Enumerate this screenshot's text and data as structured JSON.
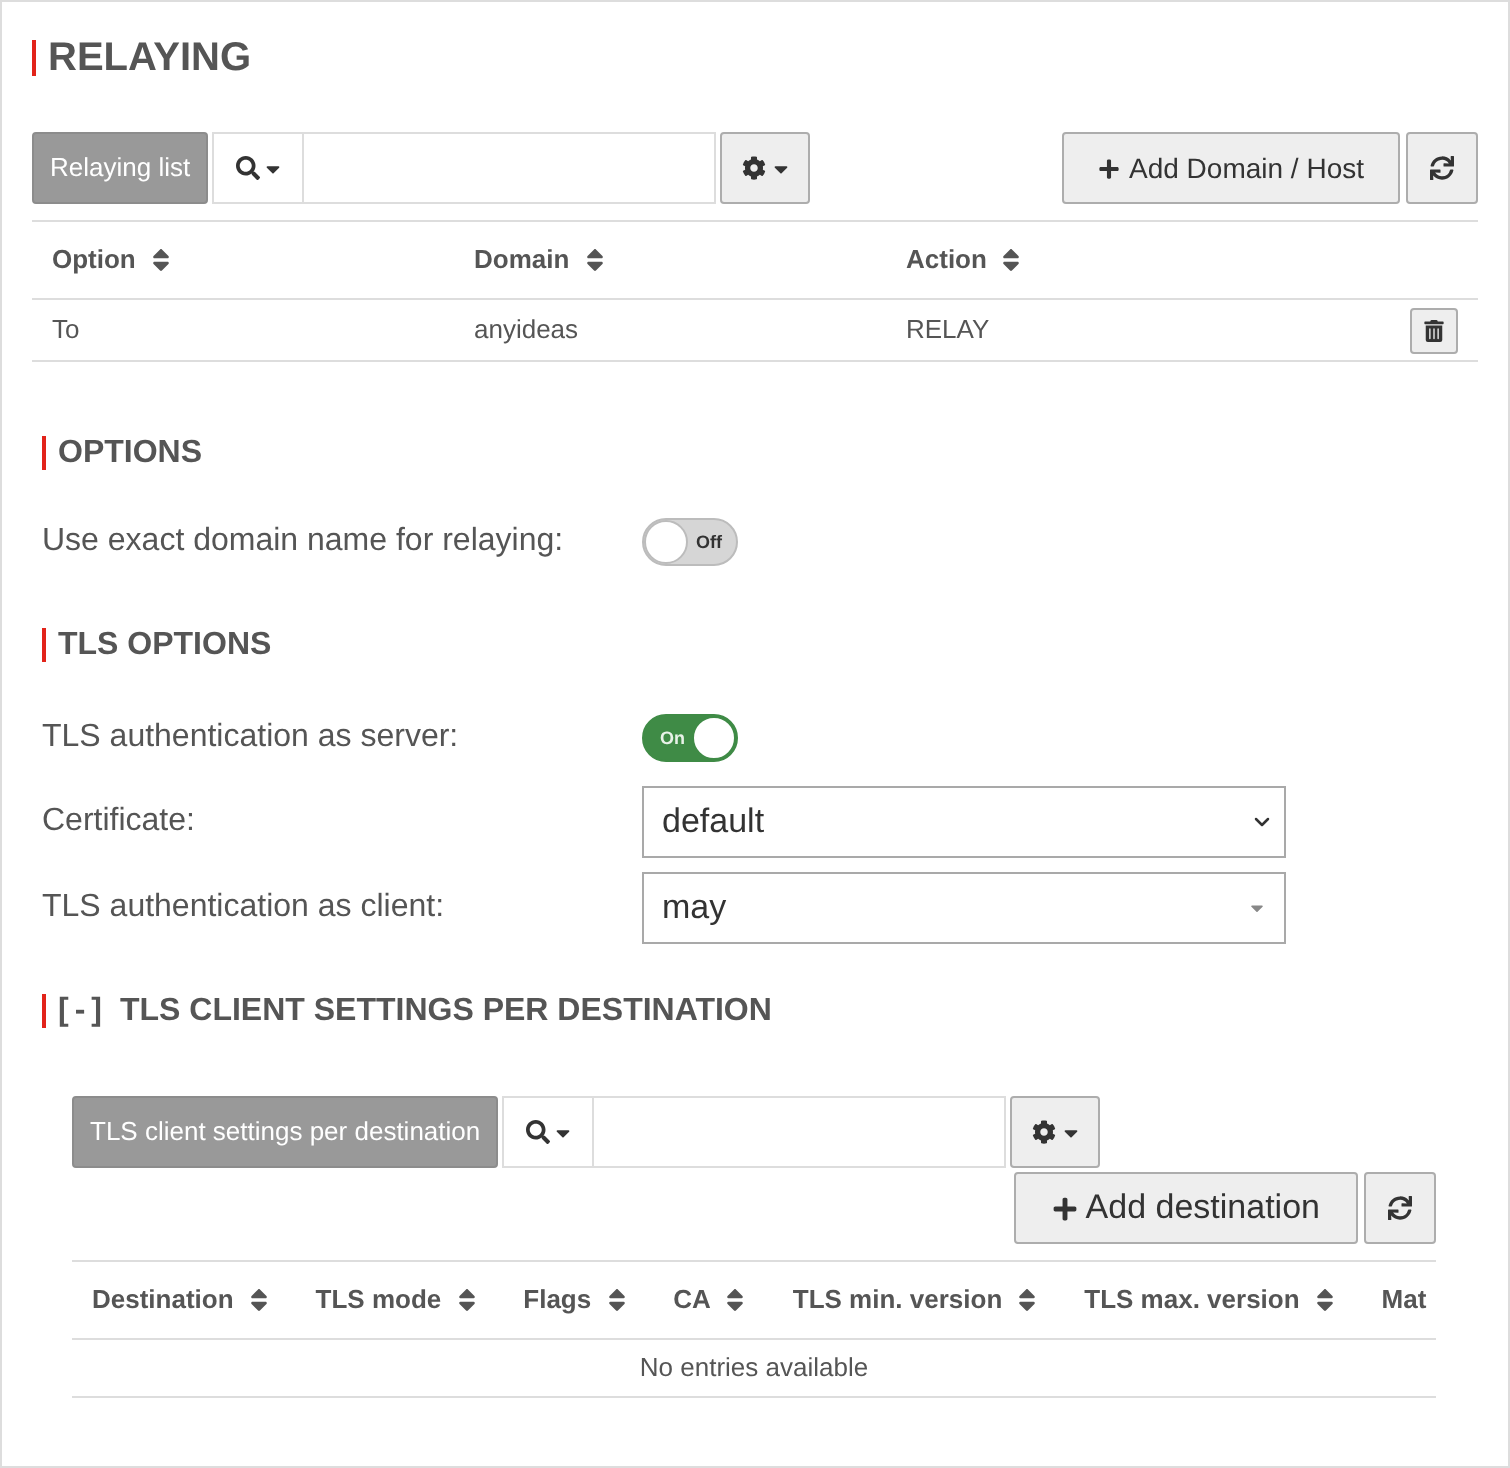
{
  "relaying": {
    "title": "RELAYING",
    "list_button": "Relaying list",
    "add_button": "Add Domain / Host",
    "table": {
      "columns": [
        "Option",
        "Domain",
        "Action"
      ],
      "rows": [
        {
          "cells": [
            "To",
            "anyideas",
            "RELAY"
          ]
        }
      ]
    }
  },
  "options": {
    "title": "OPTIONS",
    "fields": [
      {
        "kind": "toggle",
        "label": "Use exact domain name for relaying:",
        "on": false,
        "state_label": "Off"
      }
    ]
  },
  "tls_options": {
    "title": "TLS OPTIONS",
    "fields": [
      {
        "kind": "toggle",
        "label": "TLS authentication as server:",
        "on": true,
        "state_label": "On"
      },
      {
        "kind": "select",
        "label": "Certificate:",
        "value": "default"
      },
      {
        "kind": "combobox",
        "label": "TLS authentication as client:",
        "value": "may"
      }
    ]
  },
  "tls_client_settings": {
    "collapse_marker": "[-]",
    "title": "TLS CLIENT SETTINGS PER DESTINATION",
    "list_button": "TLS client settings per destination",
    "add_button": "Add destination",
    "table": {
      "columns": [
        "Destination",
        "TLS mode",
        "Flags",
        "CA",
        "TLS min. version",
        "TLS max. version",
        "Mat"
      ],
      "empty_text": "No entries available"
    }
  }
}
